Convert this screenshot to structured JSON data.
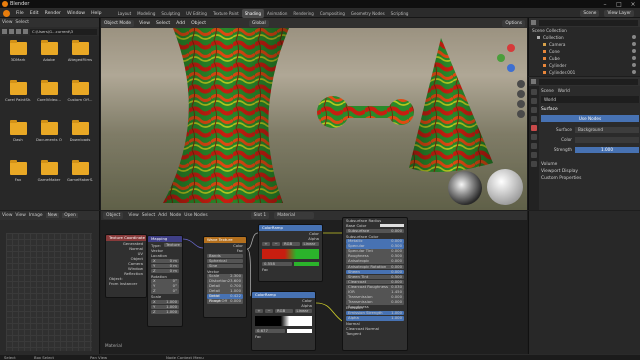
{
  "app": {
    "title": "Blender"
  },
  "menu": [
    "File",
    "Edit",
    "Render",
    "Window",
    "Help"
  ],
  "workspaces": [
    "Layout",
    "Modeling",
    "Sculpting",
    "UV Editing",
    "Texture Paint",
    "Shading",
    "Animation",
    "Rendering",
    "Compositing",
    "Geometry Nodes",
    "Scripting"
  ],
  "active_workspace": "Shading",
  "scene": {
    "name": "Scene",
    "view_layer": "View Layer"
  },
  "file_browser": {
    "header": [
      "View",
      "Select"
    ],
    "path": "C:\\Users\\G...current\\3",
    "folders": [
      "3DMark",
      "Adobe",
      "AltegedFilms",
      "Corel PaintSh...",
      "CorelVideo...",
      "Custom Off...",
      "Dash",
      "Documents Of",
      "Downloads",
      "Fax",
      "GameMaker",
      "GameMakerS..."
    ]
  },
  "viewport": {
    "mode": "Object Mode",
    "menu": [
      "View",
      "Select",
      "Add",
      "Object"
    ],
    "transform": "Global",
    "options": "Options"
  },
  "outliner": {
    "title": "Scene Collection",
    "items": [
      "Collection",
      "Camera",
      "Cone",
      "Cube",
      "Cylinder",
      "Cylinder.001",
      "Cylinder.002",
      "Light"
    ]
  },
  "properties": {
    "context": "Scene",
    "world_label": "World",
    "world": "World",
    "surface_section": "Surface",
    "use_nodes": "Use Nodes",
    "surface_label": "Surface",
    "surface_value": "Background",
    "color_label": "Color",
    "strength_label": "Strength",
    "strength_value": "1.000",
    "sections": [
      "Volume",
      "Viewport Display",
      "Custom Properties"
    ]
  },
  "image_editor": {
    "menu": [
      "View",
      "View",
      "Image"
    ],
    "new": "New",
    "open": "Open"
  },
  "node_editor": {
    "object_menu": "Object",
    "menu": [
      "View",
      "Select",
      "Add",
      "Node"
    ],
    "use_nodes": "Use Nodes",
    "slot": "Slot 1",
    "material": "Material",
    "footer": "Material",
    "texcoord": {
      "title": "Texture Coordinate",
      "outputs": [
        "Generated",
        "Normal",
        "UV",
        "Object",
        "Camera",
        "Window",
        "Reflection"
      ],
      "object": "Object:",
      "from_instancer": "From Instancer"
    },
    "mapping": {
      "title": "Mapping",
      "type": "Type:",
      "type_value": "Texture",
      "vector": "Vector",
      "location": "Location",
      "loc": [
        "0 m",
        "0 m",
        "0 m"
      ],
      "rotation": "Rotation",
      "rot": [
        "0°",
        "0°",
        "0°"
      ],
      "scale": "Scale",
      "sc": [
        "1.000",
        "1.000",
        "1.000"
      ]
    },
    "wave": {
      "title": "Wave Texture",
      "outputs": [
        "Color",
        "Fac"
      ],
      "type": "Bands",
      "dir": "Spherical",
      "profile": "Sine",
      "vector": "Vector",
      "params": [
        [
          "Scale",
          "2.300"
        ],
        [
          "Distortion",
          "23.600"
        ],
        [
          "Detail",
          "0.700"
        ],
        [
          "Detail Scale",
          "1.000"
        ],
        [
          "Detail Rough",
          "0.422"
        ],
        [
          "Phase Off",
          "0.000"
        ]
      ]
    },
    "ramp1": {
      "title": "ColorRamp",
      "outputs": [
        "Color",
        "Alpha"
      ],
      "mode": "RGB",
      "interp": "Linear",
      "pos": "0.558",
      "fac": "Fac"
    },
    "ramp2": {
      "title": "ColorRamp",
      "outputs": [
        "Color",
        "Alpha"
      ],
      "mode": "RGB",
      "interp": "Linear",
      "pos": "0.677",
      "fac": "Fac"
    },
    "bsdf": {
      "title": "Subsurface Radius",
      "rows": [
        "Subsurface Radius",
        "Base Color",
        "Subsurface",
        "Subsurface Color",
        "Metallic",
        "Specular",
        "Specular Tint",
        "Roughness",
        "Anisotropic",
        "Anisotropic Rotation",
        "Sheen",
        "Sheen Tint",
        "Clearcoat",
        "Clearcoat Roughness",
        "IOR",
        "Transmission",
        "Transmission Roughness",
        "Emission",
        "Emission Strength",
        "Alpha",
        "Normal",
        "Clearcoat Normal",
        "Tangent"
      ],
      "vals": [
        "",
        "",
        "0.000",
        "",
        "0.000",
        "0.500",
        "0.000",
        "0.500",
        "0.000",
        "0.000",
        "0.000",
        "0.500",
        "0.000",
        "0.030",
        "1.450",
        "0.000",
        "0.000",
        "",
        "1.000",
        "1.000",
        "",
        "",
        ""
      ]
    }
  },
  "statusbar": [
    "Select",
    "Box Select",
    "Pan View",
    "Node Context Menu"
  ],
  "colors": {
    "accent": "#4772b3",
    "folder": "#e9a825"
  }
}
